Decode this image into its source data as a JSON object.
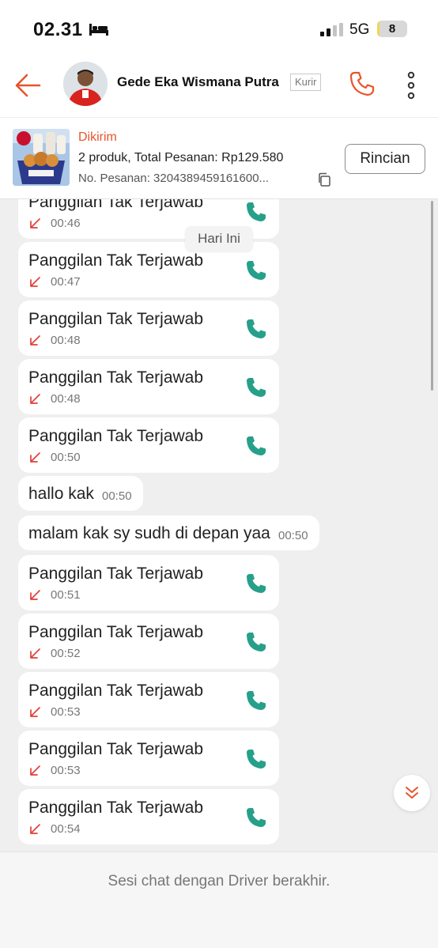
{
  "status_bar": {
    "time": "02.31",
    "network": "5G",
    "battery_level": "8",
    "battery_fraction": 0.08,
    "icons": [
      "bed-icon",
      "signal-icon"
    ]
  },
  "header": {
    "driver_name": "Gede Eka Wismana Putra",
    "role": "Kurir",
    "icons": [
      "back-arrow-icon",
      "phone-icon",
      "more-vertical-icon"
    ]
  },
  "order": {
    "status": "Dikirim",
    "summary": "2 produk, Total Pesanan: Rp129.580",
    "number": "No. Pesanan: 3204389459161600...",
    "detail_button": "Rincian"
  },
  "chat": {
    "date_label": "Hari Ini",
    "messages": [
      {
        "type": "call",
        "title": "Panggilan Tak Terjawab",
        "time": "00:46"
      },
      {
        "type": "call",
        "title": "Panggilan Tak Terjawab",
        "time": "00:47"
      },
      {
        "type": "call",
        "title": "Panggilan Tak Terjawab",
        "time": "00:48"
      },
      {
        "type": "call",
        "title": "Panggilan Tak Terjawab",
        "time": "00:48"
      },
      {
        "type": "call",
        "title": "Panggilan Tak Terjawab",
        "time": "00:50"
      },
      {
        "type": "text",
        "text": "hallo kak",
        "time": "00:50"
      },
      {
        "type": "text",
        "text": "malam kak sy sudh di depan yaa",
        "time": "00:50"
      },
      {
        "type": "call",
        "title": "Panggilan Tak Terjawab",
        "time": "00:51"
      },
      {
        "type": "call",
        "title": "Panggilan Tak Terjawab",
        "time": "00:52"
      },
      {
        "type": "call",
        "title": "Panggilan Tak Terjawab",
        "time": "00:53"
      },
      {
        "type": "call",
        "title": "Panggilan Tak Terjawab",
        "time": "00:53"
      },
      {
        "type": "call",
        "title": "Panggilan Tak Terjawab",
        "time": "00:54"
      }
    ]
  },
  "footer": {
    "text": "Sesi chat dengan Driver berakhir."
  },
  "colors": {
    "brand_orange": "#e8542d",
    "missed_call_red": "#e0403a",
    "call_green": "#26a08a",
    "chat_background": "#efefef"
  }
}
